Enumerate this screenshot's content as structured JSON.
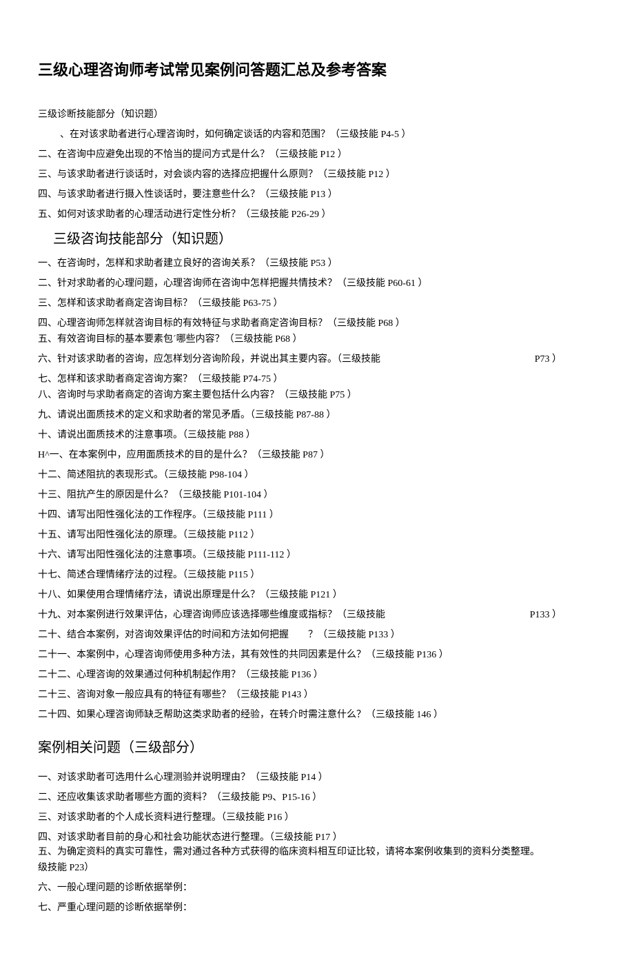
{
  "title": "三级心理咨询师考试常见案例问答题汇总及参考答案",
  "section1": {
    "heading": "三级诊断技能部分（知识题）",
    "items": [
      "、在对该求助者进行心理咨询时，如何确定谈话的内容和范围？（三级技能 P4-5 ）",
      "二、在咨询中应避免出现的不恰当的提问方式是什么？（三级技能 P12 ）",
      "三、与该求助者进行谈话时，对会谈内容的选择应把握什么原则？（三级技能 P12 ）",
      "四、与该求助者进行摄入性谈话时，要注意些什么？（三级技能 P13 ）",
      "五、如何对该求助者的心理活动进行定性分析？（三级技能 P26-29 ）"
    ]
  },
  "section2": {
    "heading": "三级咨询技能部分（知识题）",
    "items": [
      {
        "text": "一、在咨询时，怎样和求助者建立良好的咨询关系？（三级技能 P53 ）"
      },
      {
        "text": "二、针对求助者的心理问题，心理咨询师在咨询中怎样把握共情技术？（三级技能 P60-61 ）"
      },
      {
        "text": "三、怎样和该求助者商定咨询目标？（三级技能 P63-75 ）"
      },
      {
        "text": "四、心理咨询师怎样就咨询目标的有效特征与求助者商定咨询目标？（三级技能 P68 ）",
        "tight": true
      },
      {
        "text": "五、有效咨询目标的基本要素包´哪些内容？（三级技能 P68 ）"
      },
      {
        "text": "六、针对该求助者的咨询，应怎样划分咨询阶段，并说出其主要内容。（三级技能",
        "right": "P73 ）"
      },
      {
        "text": "七、怎样和该求助者商定咨询方案？（三级技能 P74-75 ）",
        "tight": true
      },
      {
        "text": "八、咨询时与求助者商定的咨询方案主要包括什么内容？（三级技能 P75 ）"
      },
      {
        "text": "九、请说出面质技术的定义和求助者的常见矛盾。（三级技能 P87-88 ）"
      },
      {
        "text": "十、请说出面质技术的注意事项。（三级技能 P88 ）"
      },
      {
        "text": "H^一、在本案例中，应用面质技术的目的是什么？（三级技能 P87 ）"
      },
      {
        "text": "十二、简述阻抗的表现形式。（三级技能 P98-104 ）"
      },
      {
        "text": "十三、阻抗产生的原因是什么？（三级技能 P101-104 ）"
      },
      {
        "text": "十四、请写出阳性强化法的工作程序。（三级技能 P111 ）"
      },
      {
        "text": "十五、请写出阳性强化法的原理。（三级技能 P112 ）"
      },
      {
        "text": "十六、请写出阳性强化法的注意事项。（三级技能 P111-112 ）"
      },
      {
        "text": "十七、简述合理情绪疗法的过程。（三级技能 P115 ）"
      },
      {
        "text": "十八、如果使用合理情绪疗法，请说出原理是什么？（三级技能 P121 ）"
      },
      {
        "text": "十九、对本案例进行效果评估，心理咨询师应该选择哪些维度或指标？（三级技能",
        "right": "P133 ）"
      },
      {
        "text": "二十、结合本案例，对咨询效果评估的时间和方法如何把握　　？（三级技能 P133 ）"
      },
      {
        "text": "二十一、本案例中，心理咨询师使用多种方法，其有效性的共同因素是什么？（三级技能 P136 ）"
      },
      {
        "text": "二十二、心理咨询的效果通过何种机制起作用？（三级技能 P136 ）"
      },
      {
        "text": "二十三、咨询对象一般应具有的特征有哪些？（三级技能 P143 ）"
      },
      {
        "text": "二十四、如果心理咨询师缺乏帮助这类求助者的经验，在转介时需注意什么？（三级技能 146 ）"
      }
    ]
  },
  "section3": {
    "heading": "案例相关问题（三级部分）",
    "items": [
      "一、对该求助者可选用什么心理测验并说明理由？（三级技能 P14 ）",
      "二、还应收集该求助者哪些方面的资料？（三级技能 P9、P15-16 ）",
      "三、对该求助者的个人成长资料进行整理。（三级技能 P16 ）",
      "四、对该求助者目前的身心和社会功能状态进行整理。（三级技能 P17 ）",
      "五、为确定资料的真实可靠性，需对通过各种方式获得的临床资料相互印证比较，请将本案例收集到的资料分类整理。",
      "级技能 P23）",
      "六、一般心理问题的诊断依据举例：",
      "七、严重心理问题的诊断依据举例："
    ]
  }
}
